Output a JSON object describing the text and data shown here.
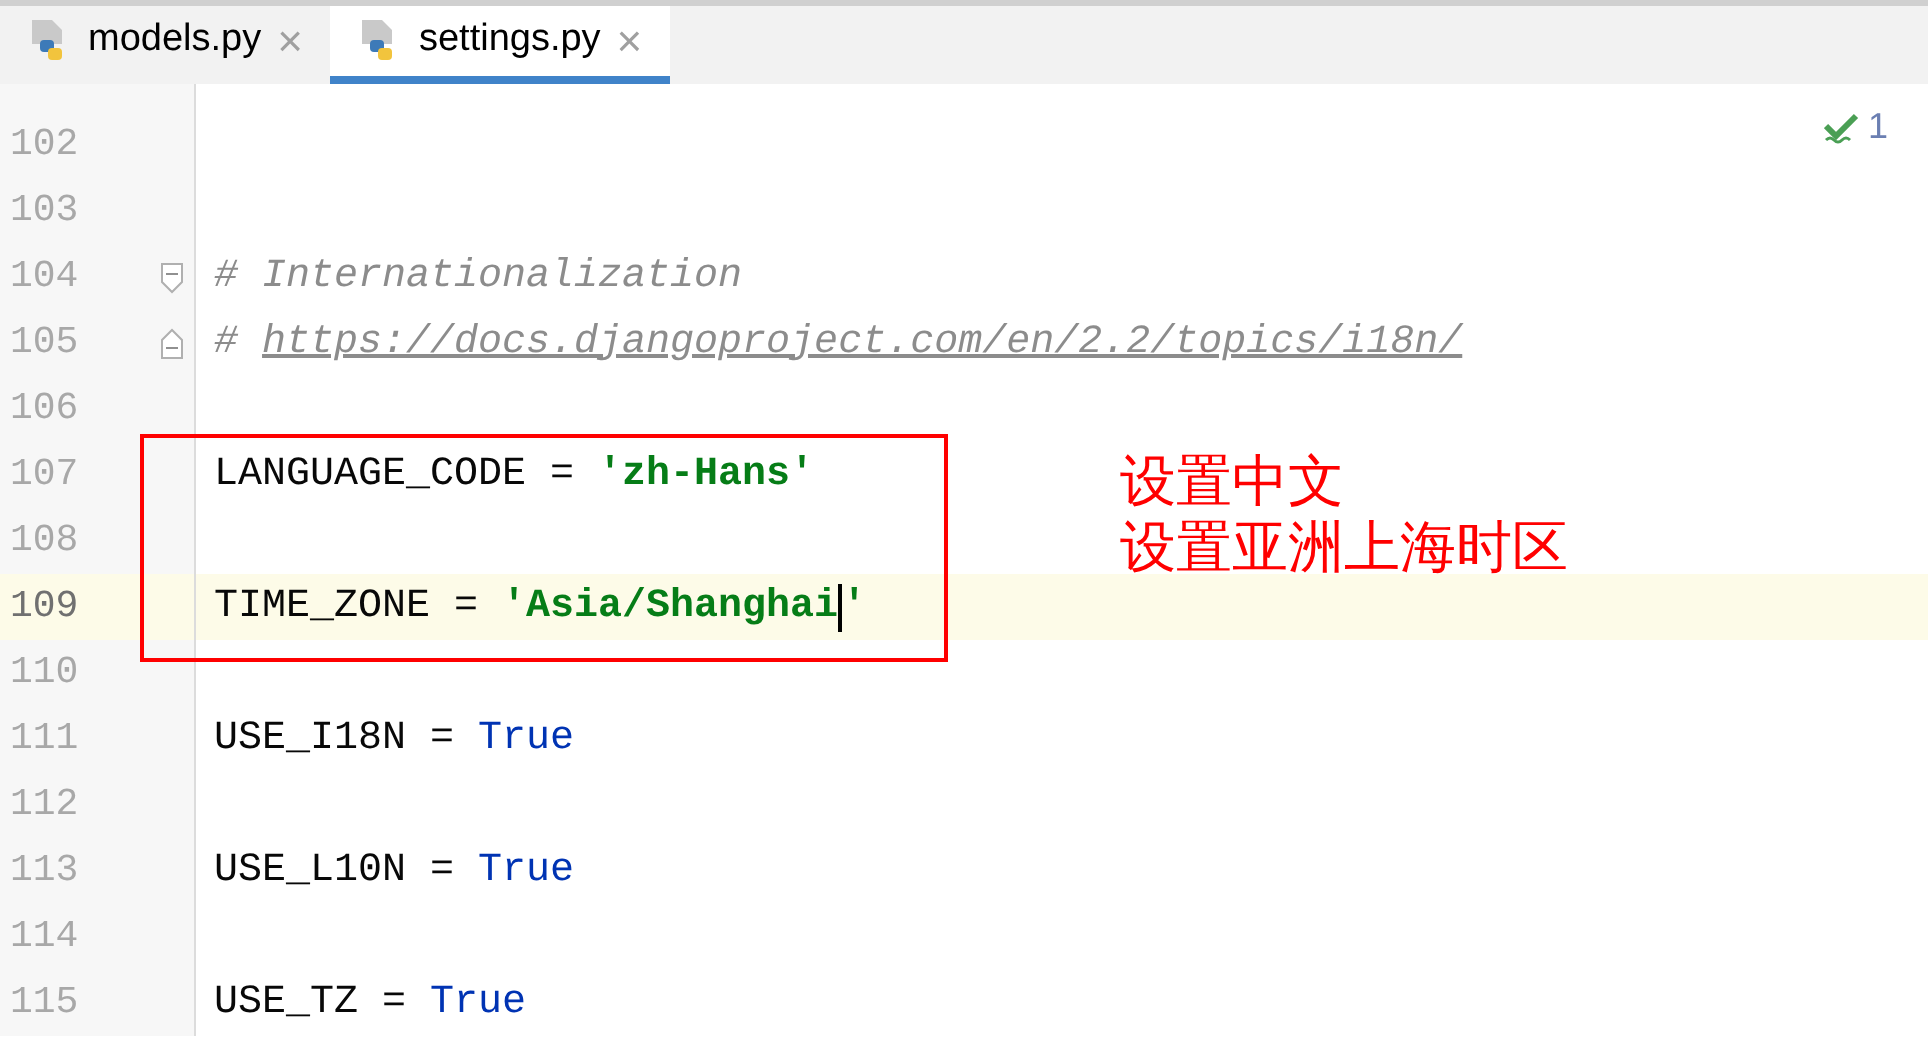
{
  "tabs": [
    {
      "label": "models.py",
      "close": "×",
      "selected": false
    },
    {
      "label": "settings.py",
      "close": "×",
      "selected": true
    }
  ],
  "inspection": {
    "count": "1"
  },
  "lines": [
    {
      "number": "102",
      "current": false
    },
    {
      "number": "103",
      "current": false
    },
    {
      "number": "104",
      "current": false,
      "kind": "fold-start",
      "tokens": [
        {
          "kind": "comment",
          "text": "# Internationalization"
        }
      ]
    },
    {
      "number": "105",
      "current": false,
      "kind": "fold-end",
      "tokens": [
        {
          "kind": "comment",
          "text": "# "
        },
        {
          "kind": "link",
          "text": "https://docs.djangoproject.com/en/2.2/topics/i18n/"
        }
      ]
    },
    {
      "number": "106",
      "current": false
    },
    {
      "number": "107",
      "current": false,
      "tokens": [
        {
          "kind": "plain",
          "text": "LANGUAGE_CODE = "
        },
        {
          "kind": "string",
          "text": "'zh-Hans'"
        }
      ]
    },
    {
      "number": "108",
      "current": false
    },
    {
      "number": "109",
      "current": true,
      "tokens": [
        {
          "kind": "plain",
          "text": "TIME_ZONE = "
        },
        {
          "kind": "string",
          "text": "'Asia/Shanghai"
        },
        {
          "kind": "caret"
        },
        {
          "kind": "string",
          "text": "'"
        }
      ]
    },
    {
      "number": "110",
      "current": false
    },
    {
      "number": "111",
      "current": false,
      "tokens": [
        {
          "kind": "plain",
          "text": "USE_I18N = "
        },
        {
          "kind": "keyword",
          "text": "True"
        }
      ]
    },
    {
      "number": "112",
      "current": false
    },
    {
      "number": "113",
      "current": false,
      "tokens": [
        {
          "kind": "plain",
          "text": "USE_L10N = "
        },
        {
          "kind": "keyword",
          "text": "True"
        }
      ]
    },
    {
      "number": "114",
      "current": false
    },
    {
      "number": "115",
      "current": false,
      "tokens": [
        {
          "kind": "plain",
          "text": "USE_TZ = "
        },
        {
          "kind": "keyword",
          "text": "True"
        }
      ]
    }
  ],
  "annotation": {
    "lines": [
      "设置中文",
      "设置亚洲上海时区"
    ]
  }
}
